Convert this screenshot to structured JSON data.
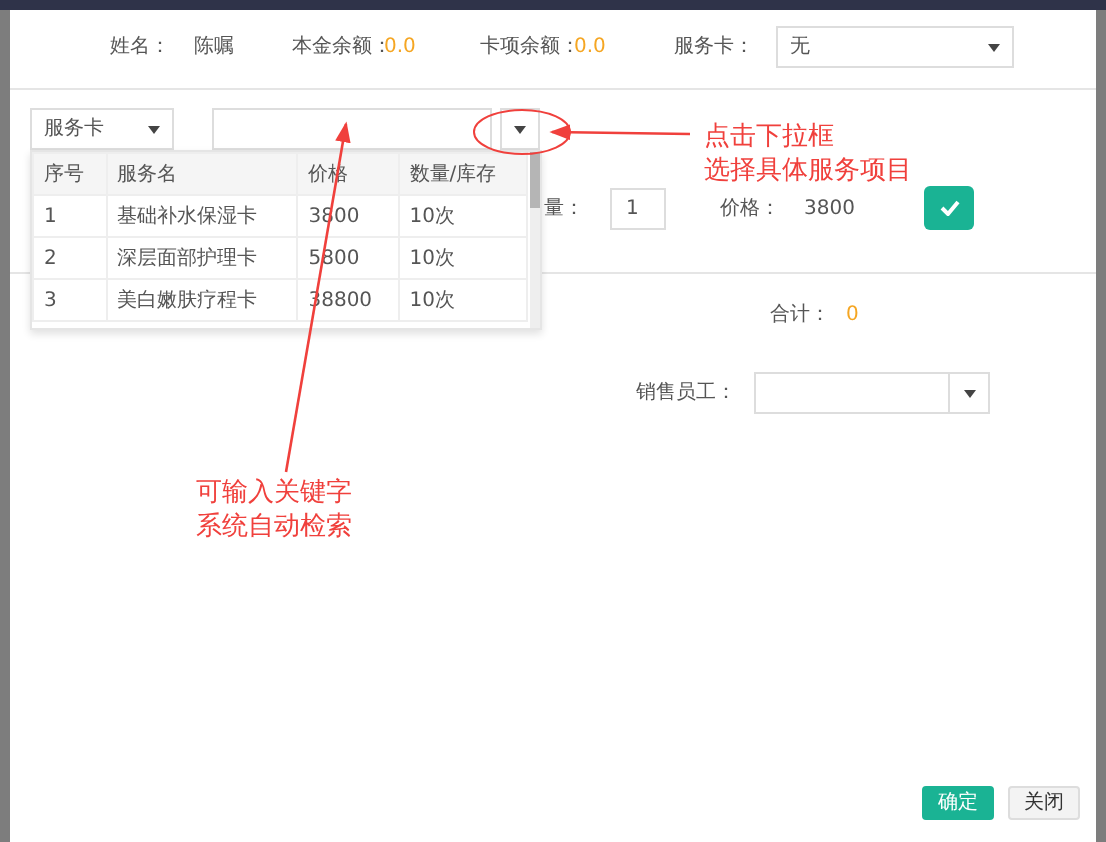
{
  "customer": {
    "name_label": "姓名：",
    "name": "陈嘱",
    "principal_label": "本金余额：",
    "principal": "0.0",
    "card_label": "卡项余额：",
    "card_balance": "0.0",
    "service_card_label": "服务卡：",
    "service_card_value": "无"
  },
  "item_picker": {
    "type_value": "服务卡"
  },
  "dropdown_table": {
    "columns": [
      "序号",
      "服务名",
      "价格",
      "数量/库存"
    ],
    "rows": [
      [
        "1",
        "基础补水保湿卡",
        "3800",
        "10次"
      ],
      [
        "2",
        "深层面部护理卡",
        "5800",
        "10次"
      ],
      [
        "3",
        "美白嫩肤疗程卡",
        "38800",
        "10次"
      ]
    ]
  },
  "quantity": {
    "label": "量：",
    "value": "1"
  },
  "price": {
    "label": "价格：",
    "value": "3800"
  },
  "total": {
    "label": "合计：",
    "value": "0"
  },
  "sales_staff": {
    "label": "销售员工："
  },
  "buttons": [
    {
      "label": "确定",
      "kind": "primary"
    },
    {
      "label": "关闭",
      "kind": "default"
    }
  ],
  "annotations": [
    {
      "lines": [
        "点击下拉框",
        "选择具体服务项目"
      ]
    },
    {
      "lines": [
        "可输入关键字",
        "系统自动检索"
      ]
    }
  ]
}
